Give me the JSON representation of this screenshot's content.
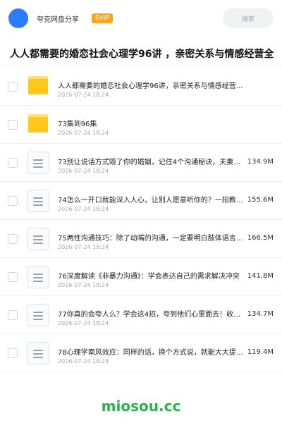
{
  "header": {
    "brand": "夸克网盘分享",
    "badge": "SVIP",
    "search_label": "搜索",
    "colors": {
      "avatar": "#2b7cff",
      "badge": "#f5a623"
    }
  },
  "page_title": "人人都需要的婚恋社会心理学96讲 ，亲密关系与情感经营全",
  "files": [
    {
      "type": "folder",
      "name": "人人都需要的婚恋社会心理学96讲，亲密关系与情感经营全攻略",
      "date": "2026-07-24 18:24",
      "size": ""
    },
    {
      "type": "folder",
      "name": "73集到96集",
      "date": "2026-07-24 18:24",
      "size": ""
    },
    {
      "type": "file",
      "name": "73别让说话方式毁了你的婚姻，记住4个沟通秘诀，夫妻更恩爱",
      "date": "2026-07-24 18:24",
      "size": "134.9M"
    },
    {
      "type": "file",
      "name": "74怎么一开口就能深入人心，让别人愿意听你的？一招教会你",
      "date": "2026-07-24 18:24",
      "size": "155.6M"
    },
    {
      "type": "file",
      "name": "75两性沟通技巧：除了动嘴的沟通，一定要明白肢体语言的重要",
      "date": "2026-07-24 18:24",
      "size": "166.5M"
    },
    {
      "type": "file",
      "name": "76深度解读《非暴力沟通》：学会表达自己的需求解决冲突",
      "date": "2026-07-24 18:24",
      "size": "141.8M"
    },
    {
      "type": "file",
      "name": "77你真的会夸人么？学会这4招，夸到他们心里面去！收获好人缘",
      "date": "2026-07-24 18:24",
      "size": "134.7M"
    },
    {
      "type": "file",
      "name": "78心理学南风效应：同样的话，换个方式说，就能大大提升效果",
      "date": "2026-07-24 18:24",
      "size": "119.4M"
    }
  ],
  "watermark": "miosou.cc"
}
